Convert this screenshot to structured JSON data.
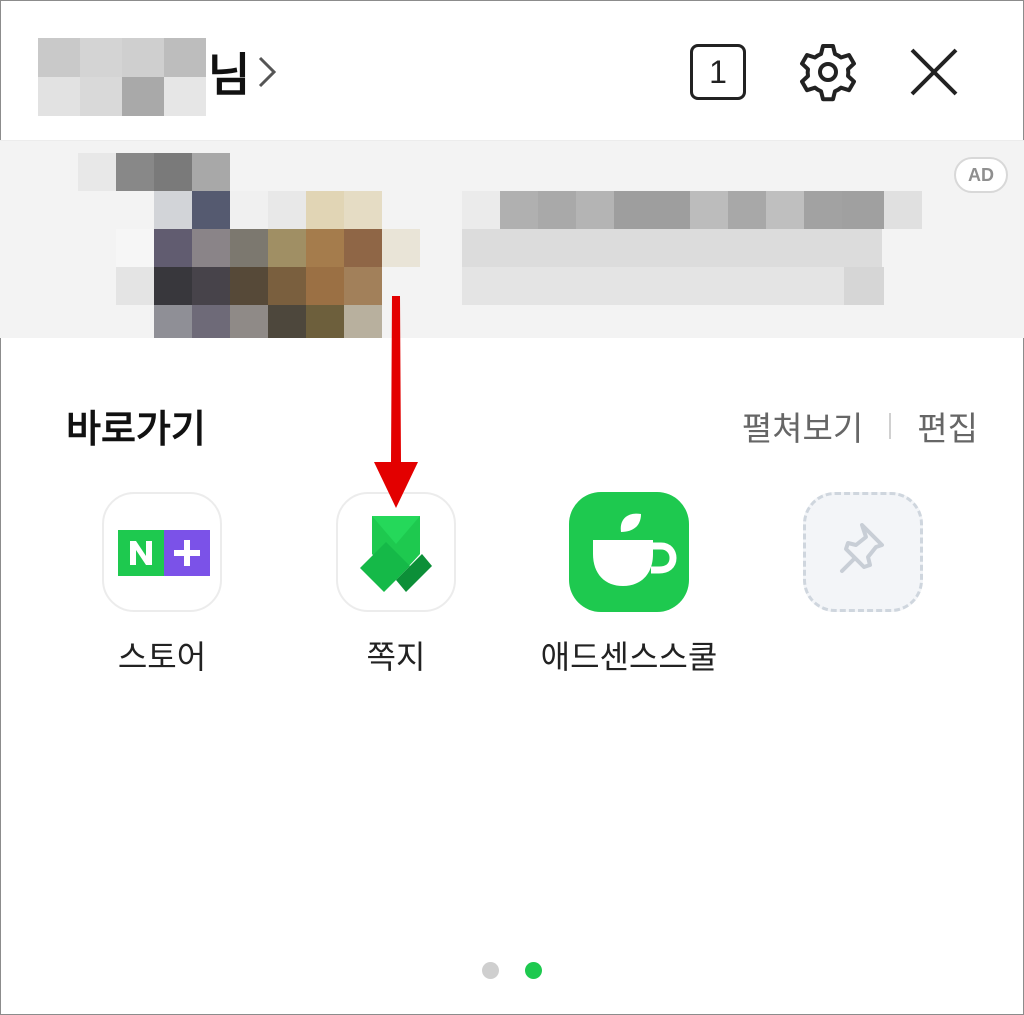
{
  "header": {
    "user_suffix": "님",
    "tab_count": "1"
  },
  "ad": {
    "badge": "AD"
  },
  "shortcuts": {
    "title": "바로가기",
    "expand_label": "펼쳐보기",
    "edit_label": "편집",
    "items": [
      {
        "label": "스토어",
        "icon": "naver-plus-store-icon"
      },
      {
        "label": "쪽지",
        "icon": "note-icon"
      },
      {
        "label": "애드센스스쿨",
        "icon": "cafe-icon"
      },
      {
        "label": "",
        "icon": "pin-icon"
      }
    ]
  },
  "pagination": {
    "pages": 2,
    "current": 2
  },
  "colors": {
    "accent_green": "#1EC94F",
    "store_purple": "#7B52E8",
    "annotation_red": "#E30000"
  }
}
